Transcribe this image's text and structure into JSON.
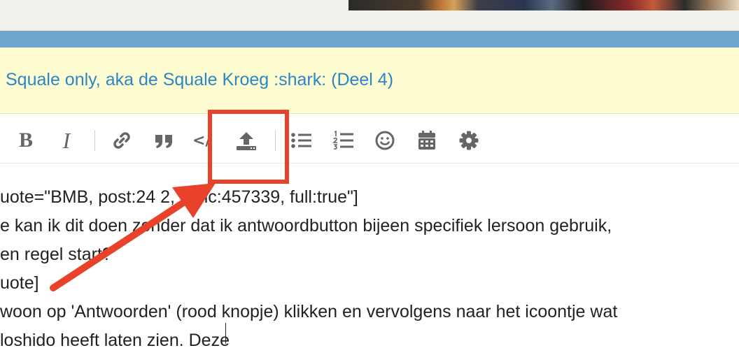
{
  "topic": {
    "title": "Squale only, aka de Squale Kroeg :shark: (Deel 4)"
  },
  "toolbar": {
    "bold_label": "B",
    "italic_label": "I",
    "code_label": "</>",
    "items": [
      "bold",
      "italic",
      "link",
      "blockquote",
      "preformatted-text",
      "upload",
      "bulleted-list",
      "numbered-list",
      "insert-emoji",
      "insert-date",
      "options"
    ]
  },
  "editor": {
    "lines": [
      "uote=\"BMB, post:24 2, topic:457339, full:true\"]",
      "e kan ik dit doen zonder dat ik antwoordbutton bijeen specifiek lersoon gebruik,",
      "en regel start?",
      "uote]",
      "woon op 'Antwoorden' (rood knopje) klikken en vervolgens naar het icoontje wat",
      "loshido heeft laten zien. Deze"
    ]
  },
  "annotation": {
    "color": "#e8432a"
  },
  "colors": {
    "accent": "#2c86c5",
    "bar": "#6ea6cd",
    "title_bg": "#fefdd1"
  }
}
